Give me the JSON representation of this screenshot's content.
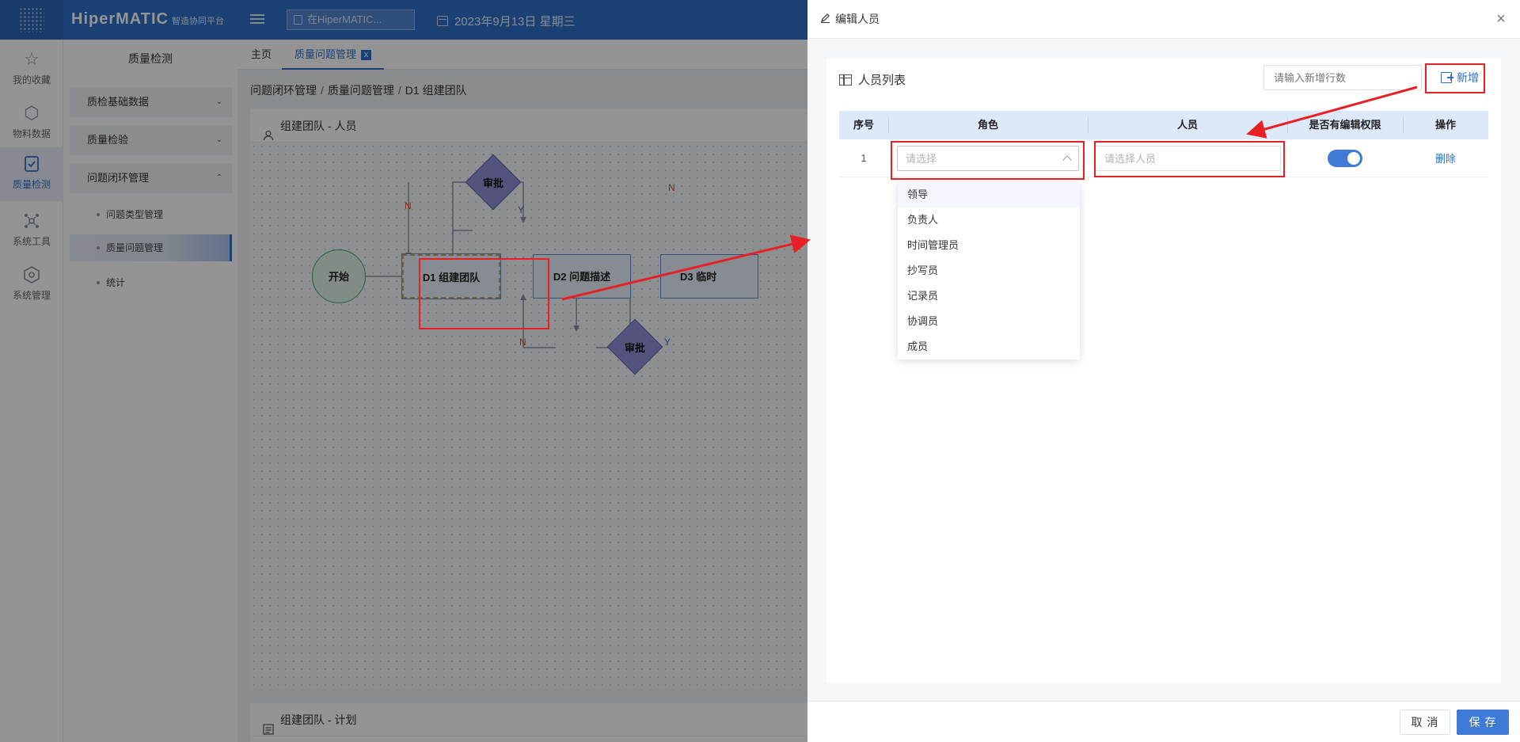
{
  "topbar": {
    "brand": "HiperMATIC",
    "brand_sub": "智造协同平台",
    "search_placeholder": "在HiperMATIC...",
    "date": "2023年9月13日 星期三"
  },
  "rail": [
    {
      "label": "我的收藏",
      "icon": "star-icon"
    },
    {
      "label": "物料数据",
      "icon": "cube-icon"
    },
    {
      "label": "质量检测",
      "icon": "shield-check-icon"
    },
    {
      "label": "系统工具",
      "icon": "network-icon"
    },
    {
      "label": "系统管理",
      "icon": "box-gear-icon"
    }
  ],
  "submenu": {
    "title": "质量检测",
    "groups": [
      "质检基础数据",
      "质量检验",
      "问题闭环管理"
    ],
    "subitems": [
      "问题类型管理",
      "质量问题管理",
      "统计"
    ]
  },
  "tabs": [
    {
      "label": "主页"
    },
    {
      "label": "质量问题管理",
      "close": "x"
    }
  ],
  "breadcrumb": [
    "问题闭环管理",
    "质量问题管理",
    "D1 组建团队"
  ],
  "panels": {
    "team_title": "组建团队 - 人员",
    "plan_title": "组建团队 - 计划"
  },
  "flow": {
    "start": "开始",
    "d1": "D1 组建团队",
    "d2": "D2 问题描述",
    "d3": "D3 临时",
    "approve": "审批",
    "no": "N",
    "yes": "Y"
  },
  "drawer": {
    "title": "编辑人员",
    "close": "×",
    "list_title": "人员列表",
    "rows_placeholder": "请输入新增行数",
    "add_label": "新增",
    "columns": [
      "序号",
      "角色",
      "人员",
      "是否有编辑权限",
      "操作"
    ],
    "row": {
      "index": "1",
      "role_placeholder": "请选择",
      "person_placeholder": "请选择人员",
      "editable": true,
      "delete_label": "删除"
    },
    "role_options": [
      "领导",
      "负责人",
      "时间管理员",
      "抄写员",
      "记录员",
      "协调员",
      "成员"
    ],
    "cancel_label": "取 消",
    "save_label": "保 存"
  },
  "colors": {
    "brand": "#2d6fc9",
    "annotation": "#e81f25",
    "diamond": "#8f8fd8"
  }
}
